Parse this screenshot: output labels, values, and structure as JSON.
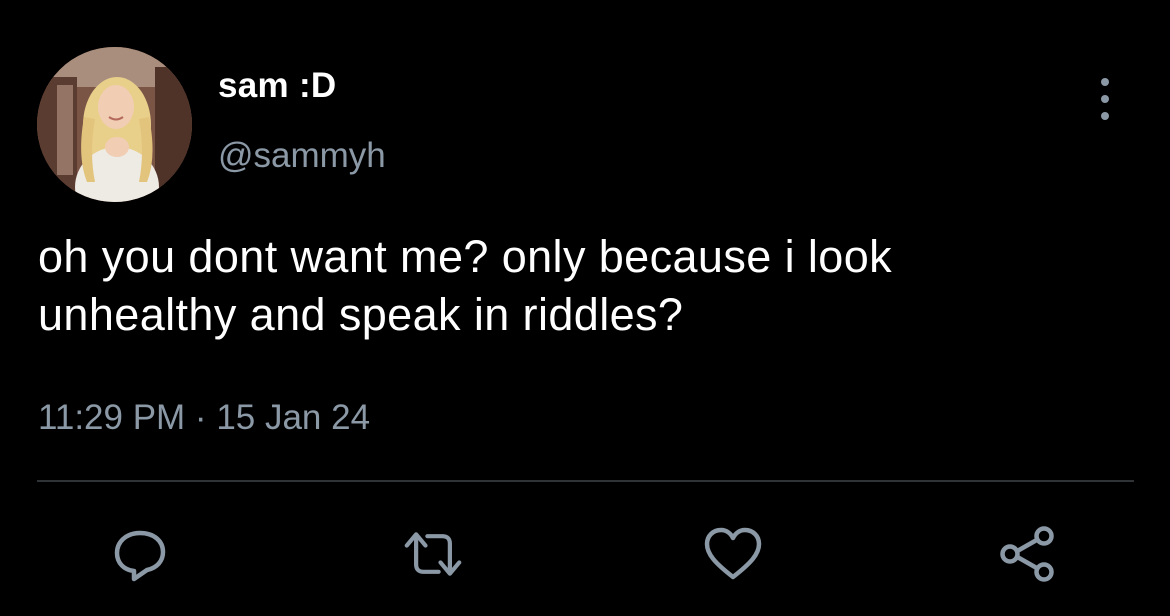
{
  "user": {
    "display_name": "sam :D",
    "handle": "@sammyh",
    "avatar_icon": "profile-photo"
  },
  "tweet": {
    "text_lines": [
      "oh you dont want me? only because i look",
      "unhealthy and speak in riddles?"
    ],
    "timestamp": "11:29 PM · 15 Jan 24"
  },
  "actions": [
    {
      "name": "reply",
      "icon": "reply-icon"
    },
    {
      "name": "retweet",
      "icon": "retweet-icon"
    },
    {
      "name": "like",
      "icon": "heart-icon"
    },
    {
      "name": "share",
      "icon": "share-icon"
    }
  ],
  "colors": {
    "background": "#000000",
    "primary_text": "#ffffff",
    "secondary_text": "#8b98a5",
    "divider": "#2f3336"
  }
}
